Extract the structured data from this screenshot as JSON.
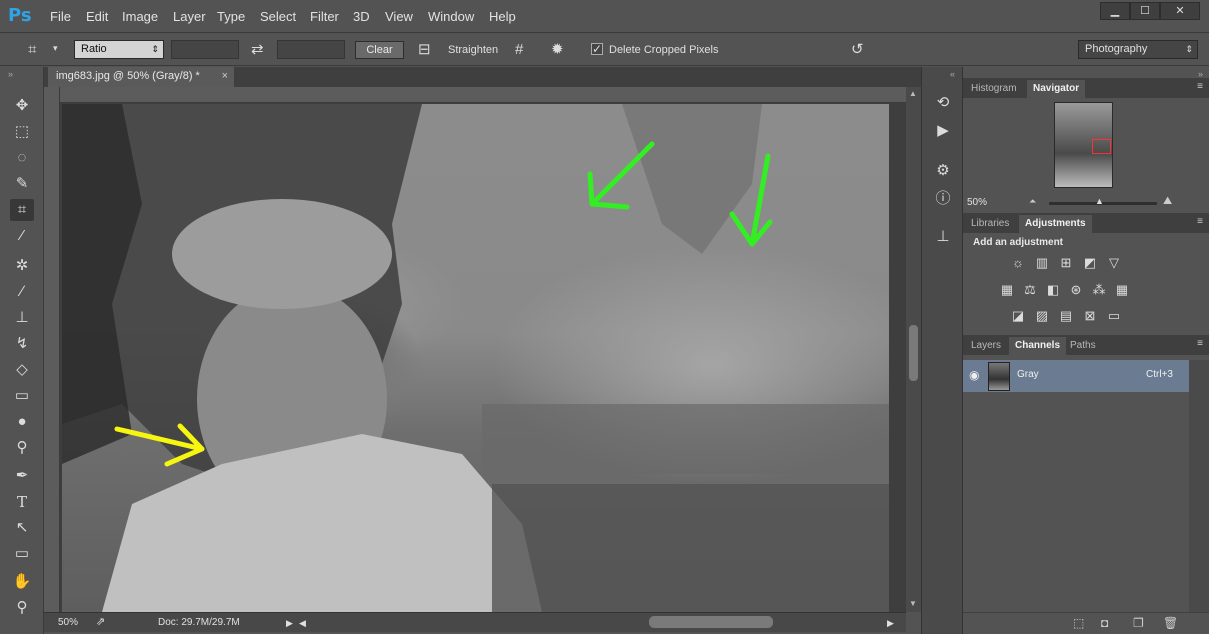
{
  "app": {
    "logo": "Ps",
    "menu": [
      "File",
      "Edit",
      "Image",
      "Layer",
      "Type",
      "Select",
      "Filter",
      "3D",
      "View",
      "Window",
      "Help"
    ],
    "window_controls": [
      "▁",
      "☐",
      "✕"
    ]
  },
  "options_bar": {
    "ratio_value": "Ratio",
    "clear_label": "Clear",
    "straighten_label": "Straighten",
    "delete_cropped_label": "Delete Cropped Pixels",
    "delete_cropped_checked": true,
    "workspace_value": "Photography"
  },
  "toolbar": {
    "tools": [
      "move-tool",
      "marquee-tool",
      "lasso-tool",
      "quick-select-tool",
      "crop-tool",
      "eyedropper-tool",
      "healing-tool",
      "brush-tool",
      "stamp-tool",
      "history-brush-tool",
      "eraser-tool",
      "gradient-tool",
      "blur-tool",
      "dodge-tool",
      "pen-tool",
      "type-tool",
      "path-select-tool",
      "shape-tool",
      "hand-tool",
      "zoom-tool"
    ],
    "active_tool": "crop-tool",
    "type_glyph": "T"
  },
  "document": {
    "tab_title": "img683.jpg @ 50% (Gray/8) *",
    "close_glyph": "×",
    "zoom": "50%",
    "doc_info": "Doc: 29.7M/29.7M"
  },
  "annotations": {
    "green_arrows": 2,
    "yellow_arrows": 1,
    "green_color": "#33ee22",
    "yellow_color": "#f6f610"
  },
  "navigator_panel": {
    "tabs": [
      "Histogram",
      "Navigator"
    ],
    "active_tab": "Navigator",
    "zoom": "50%"
  },
  "adjustments_panel": {
    "tabs": [
      "Libraries",
      "Adjustments"
    ],
    "active_tab": "Adjustments",
    "heading": "Add an adjustment"
  },
  "layers_panel": {
    "tabs": [
      "Layers",
      "Channels",
      "Paths"
    ],
    "active_tab": "Channels",
    "channels": [
      {
        "name": "Gray",
        "shortcut": "Ctrl+3",
        "visible": true,
        "selected": true
      }
    ]
  },
  "colors": {
    "bg": "#535353",
    "selection": "#6b7b92",
    "ps_blue": "#2fa3e8"
  }
}
